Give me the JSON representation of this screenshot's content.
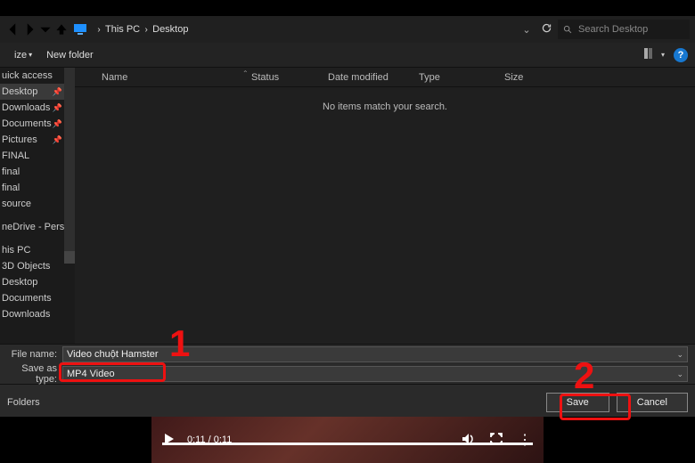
{
  "topbar": {
    "breadcrumb": [
      "This PC",
      "Desktop"
    ],
    "search_placeholder": "Search Desktop"
  },
  "toolbar": {
    "organize": "ize",
    "new_folder": "New folder"
  },
  "sidebar": {
    "items": [
      {
        "label": "uick access",
        "pin": false
      },
      {
        "label": "Desktop",
        "pin": true,
        "selected": true
      },
      {
        "label": "Downloads",
        "pin": true
      },
      {
        "label": "Documents",
        "pin": true
      },
      {
        "label": "Pictures",
        "pin": true
      },
      {
        "label": "FINAL",
        "pin": false
      },
      {
        "label": "final",
        "pin": false
      },
      {
        "label": "final",
        "pin": false
      },
      {
        "label": "source",
        "pin": false
      }
    ],
    "onedrive": "neDrive - Person",
    "this_pc_items": [
      "his PC",
      "3D Objects",
      "Desktop",
      "Documents",
      "Downloads"
    ]
  },
  "list": {
    "columns": {
      "name": "Name",
      "status": "Status",
      "date": "Date modified",
      "type": "Type",
      "size": "Size"
    },
    "empty_text": "No items match your search."
  },
  "fields": {
    "file_name_label": "File name:",
    "file_name_value": "Video chuột Hamster",
    "save_type_label": "Save as type:",
    "save_type_value": "MP4 Video"
  },
  "folder_row": {
    "folders": "Folders",
    "save": "Save",
    "cancel": "Cancel"
  },
  "annotations": {
    "num1": "1",
    "num2": "2"
  },
  "video": {
    "time": "0:11 / 0:11"
  }
}
